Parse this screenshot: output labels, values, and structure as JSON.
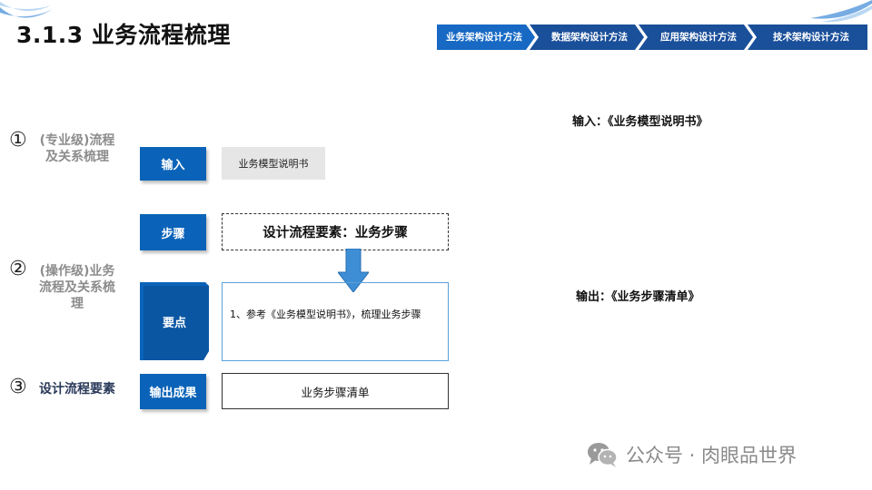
{
  "header": {
    "title": "3.1.3 业务流程梳理",
    "steps": [
      {
        "label": "业务架构设计方法",
        "active": true
      },
      {
        "label": "数据架构设计方法",
        "active": false
      },
      {
        "label": "应用架构设计方法",
        "active": false
      },
      {
        "label": "技术架构设计方法",
        "active": false
      }
    ]
  },
  "phases": [
    {
      "marker": "①",
      "label": "(专业级)流程及关系梳理"
    },
    {
      "marker": "②",
      "label": "(操作级)业务流程及关系梳理"
    },
    {
      "marker": "③",
      "label": "设计流程要素"
    }
  ],
  "rows": {
    "input": {
      "tag": "输入",
      "content": "业务模型说明书"
    },
    "steps": {
      "tag": "步骤",
      "content": "设计流程要素：业务步骤"
    },
    "points": {
      "tag": "要点",
      "content": "1、参考《业务模型说明书》，梳理业务步骤"
    },
    "output": {
      "tag": "输出成果",
      "content": "业务步骤清单"
    }
  },
  "io": {
    "input_label": "输入：《业务模型说明书》",
    "output_label": "输出：《业务步骤清单》"
  },
  "watermark": {
    "icon": "wechat-icon",
    "text": "公众号 · 肉眼品世界"
  },
  "colors": {
    "primary_blue": "#0a63b8",
    "dark_blue": "#0c3e7c",
    "nav_blue": "#1a4f9a",
    "border_light_blue": "#5aa0d8",
    "gray_fill": "#e6e6e6",
    "arrow_blue": "#3e8ed6"
  }
}
